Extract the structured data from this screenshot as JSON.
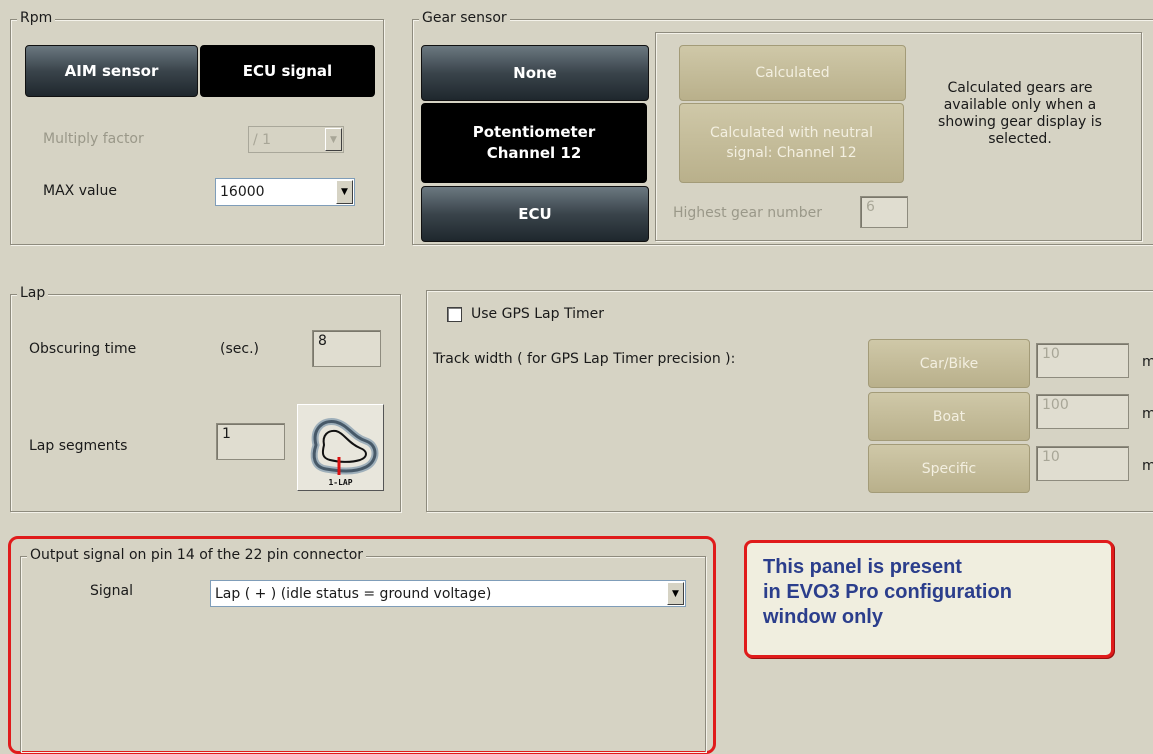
{
  "rpm": {
    "legend": "Rpm",
    "aim_sensor_label": "AIM sensor",
    "ecu_signal_label": "ECU signal",
    "multiply_factor_label": "Multiply factor",
    "multiply_factor_value": "/ 1",
    "max_value_label": "MAX value",
    "max_value": "16000"
  },
  "gear_sensor": {
    "legend": "Gear sensor",
    "none_label": "None",
    "potentiometer_label": "Potentiometer Channel 12",
    "ecu_label": "ECU",
    "calculated_label": "Calculated",
    "calculated_neutral_label": "Calculated with neutral signal: Channel 12",
    "note": "Calculated gears are available only when a showing gear display is selected.",
    "highest_gear_label": "Highest gear number",
    "highest_gear_value": "6"
  },
  "lap": {
    "legend": "Lap",
    "obscuring_time_label": "Obscuring time",
    "sec_label": "(sec.)",
    "obscuring_time_value": "8",
    "lap_segments_label": "Lap segments",
    "lap_segments_value": "1",
    "lap_icon_text": "1-LAP"
  },
  "gps": {
    "use_gps_label": "Use GPS Lap Timer",
    "use_gps_checked": false,
    "track_width_label": "Track width ( for GPS Lap Timer precision ):",
    "options": [
      {
        "label": "Car/Bike",
        "value": "10",
        "unit": "m"
      },
      {
        "label": "Boat",
        "value": "100",
        "unit": "m"
      },
      {
        "label": "Specific",
        "value": "10",
        "unit": "m"
      }
    ]
  },
  "output": {
    "legend": "Output signal on pin 14 of the 22 pin connector",
    "signal_label": "Signal",
    "signal_value": "Lap ( + ) (idle status = ground voltage)"
  },
  "callout": {
    "line1": "This panel is present",
    "line2": "in EVO3 Pro configuration",
    "line3": "window only"
  },
  "colors": {
    "background": "#d6d3c4",
    "highlight_red": "#e01b1b",
    "callout_text": "#2b3e8c"
  }
}
